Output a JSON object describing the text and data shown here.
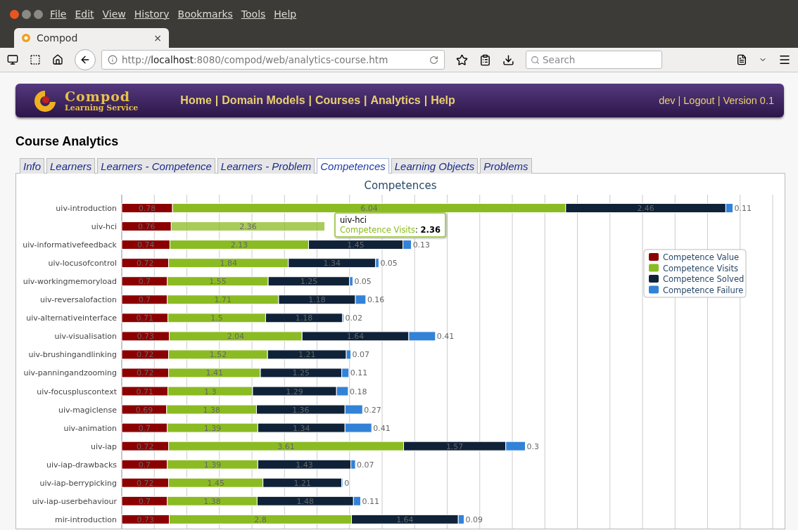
{
  "window": {
    "menu": [
      "File",
      "Edit",
      "View",
      "History",
      "Bookmarks",
      "Tools",
      "Help"
    ]
  },
  "browser_tab": {
    "title": "Compod",
    "close": "×"
  },
  "toolbar": {
    "url": "http://**localhost**:8080/compod/web/analytics-course.htm",
    "search": {
      "placeholder": "Search"
    }
  },
  "header": {
    "logo_title": "Compod",
    "logo_subtitle": "Learning Service",
    "separator": "|",
    "nav": [
      "Home",
      "Domain Models",
      "Courses",
      "Analytics",
      "Help"
    ],
    "user_menu": [
      "dev",
      "Logout",
      "Version 0.1"
    ]
  },
  "page_title": "Course Analytics",
  "tabs": [
    {
      "label": "Info",
      "selected": false
    },
    {
      "label": "Learners",
      "selected": false
    },
    {
      "label": "Learners - Competence",
      "selected": false
    },
    {
      "label": "Learners - Problem",
      "selected": false
    },
    {
      "label": "Competences",
      "selected": true
    },
    {
      "label": "Learning Objects",
      "selected": false
    },
    {
      "label": "Problems",
      "selected": false
    }
  ],
  "chart": {
    "chart_data": {
      "type": "bar",
      "title": "Competences",
      "orientation": "horizontal",
      "stacked": true,
      "data_labels": true,
      "xlim": [
        0,
        10
      ],
      "legend": "right",
      "categories": [
        "uiv-introduction",
        "uiv-hci",
        "uiv-informativefeedback",
        "uiv-locusofcontrol",
        "uiv-workingmemoryload",
        "uiv-reversalofaction",
        "uiv-alternativeinterface",
        "uiv-visualisation",
        "uiv-brushingandlinking",
        "uiv-panningandzooming",
        "uiv-focuspluscontext",
        "uiv-magiclense",
        "uiv-animation",
        "uiv-iap",
        "uiv-iap-drawbacks",
        "uiv-iap-berrypicking",
        "uiv-iap-userbehaviour",
        "mir-introduction"
      ],
      "series": [
        {
          "name": "Competence Value",
          "color": "#8b0000",
          "values": [
            0.78,
            0.76,
            0.74,
            0.72,
            0.7,
            0.7,
            0.71,
            0.73,
            0.72,
            0.72,
            0.71,
            0.69,
            0.7,
            0.72,
            0.7,
            0.72,
            0.7,
            0.73
          ]
        },
        {
          "name": "Competence Visits",
          "color": "#8bbb22",
          "values": [
            6.04,
            2.36,
            2.13,
            1.84,
            1.55,
            1.71,
            1.5,
            2.04,
            1.52,
            1.41,
            1.3,
            1.38,
            1.39,
            3.61,
            1.39,
            1.45,
            1.38,
            2.8
          ]
        },
        {
          "name": "Competence Solved",
          "color": "#0f2238",
          "values": [
            2.46,
            null,
            1.45,
            1.34,
            1.25,
            1.18,
            1.18,
            1.64,
            1.21,
            1.25,
            1.29,
            1.36,
            1.34,
            1.57,
            1.43,
            1.21,
            1.48,
            1.64
          ]
        },
        {
          "name": "Competence Failure",
          "color": "#3282d8",
          "values": [
            0.11,
            null,
            0.13,
            0.05,
            0.05,
            0.16,
            0.02,
            0.41,
            0.07,
            0.11,
            0.18,
            0.27,
            0.41,
            0.3,
            0.07,
            0,
            0.11,
            0.09
          ]
        }
      ]
    },
    "tooltip": {
      "category": "uiv-hci",
      "series": "Competence Visits",
      "separator": ":",
      "value": "2.36"
    }
  }
}
